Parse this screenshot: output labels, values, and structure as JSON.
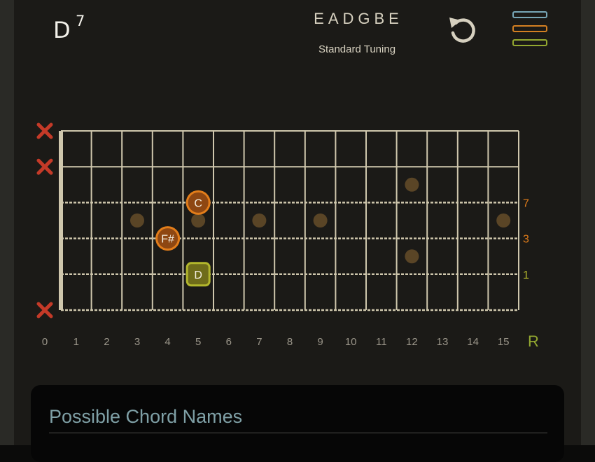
{
  "chord": {
    "root": "D",
    "quality": "7"
  },
  "tuning": {
    "notes": "EADGBE",
    "name": "Standard Tuning"
  },
  "icons": {
    "undo": "undo-icon",
    "menu": "menu-icon",
    "mute": "mute-x-icon"
  },
  "colors": {
    "background": "#1b1a17",
    "fret": "#cfc7ad",
    "inlay": "#5a4526",
    "orange": "#e27d1a",
    "olive": "#b2b62c",
    "mute": "#c43a28",
    "menu_blue": "#77a6b6",
    "menu_orange": "#d37f22",
    "menu_green": "#93a830"
  },
  "fretboard": {
    "fret_numbers": [
      "0",
      "1",
      "2",
      "3",
      "4",
      "5",
      "6",
      "7",
      "8",
      "9",
      "10",
      "11",
      "12",
      "13",
      "14",
      "15"
    ],
    "root_label": "R",
    "muted_strings": [
      1,
      2,
      6
    ],
    "inlay_markers": [
      {
        "fret": 12,
        "string": 2.5
      },
      {
        "fret": 3,
        "string": 3.5
      },
      {
        "fret": 5,
        "string": 3.5
      },
      {
        "fret": 7,
        "string": 3.5
      },
      {
        "fret": 9,
        "string": 3.5
      },
      {
        "fret": 15,
        "string": 3.5
      },
      {
        "fret": 12,
        "string": 4.5
      }
    ],
    "notes": [
      {
        "string": 3,
        "fret": 5,
        "label": "C",
        "interval": "7",
        "role": "interval"
      },
      {
        "string": 4,
        "fret": 4,
        "label": "F#",
        "interval": "3",
        "role": "interval"
      },
      {
        "string": 5,
        "fret": 5,
        "label": "D",
        "interval": "1",
        "role": "root"
      }
    ]
  },
  "panel": {
    "title": "Possible Chord Names"
  }
}
